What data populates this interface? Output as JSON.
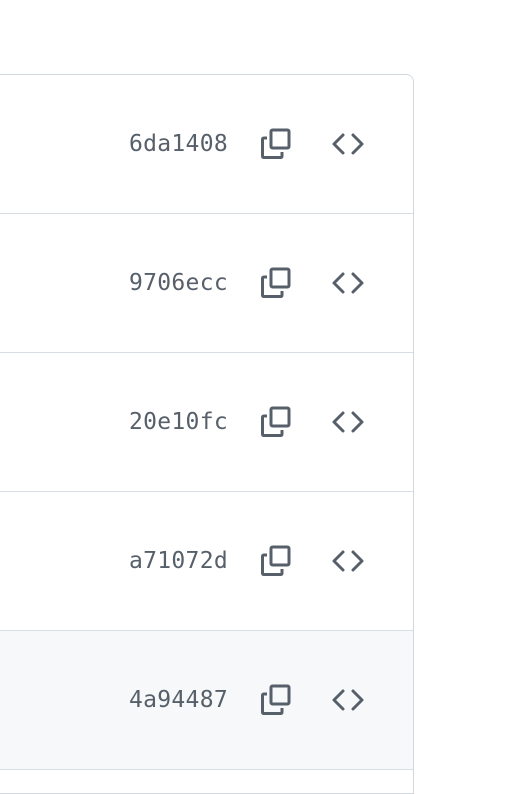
{
  "commits": [
    {
      "sha": "6da1408",
      "copy_icon": "copy-icon",
      "browse_icon": "code-brackets-icon",
      "highlighted": false
    },
    {
      "sha": "9706ecc",
      "copy_icon": "copy-icon",
      "browse_icon": "code-brackets-icon",
      "highlighted": false
    },
    {
      "sha": "20e10fc",
      "copy_icon": "copy-icon",
      "browse_icon": "code-brackets-icon",
      "highlighted": false
    },
    {
      "sha": "a71072d",
      "copy_icon": "copy-icon",
      "browse_icon": "code-brackets-icon",
      "highlighted": false
    },
    {
      "sha": "4a94487",
      "copy_icon": "copy-icon",
      "browse_icon": "code-brackets-icon",
      "highlighted": true
    }
  ],
  "colors": {
    "sha_text": "#57606a",
    "icon": "#57606a",
    "border": "#d0d7de",
    "row_divider": "#d8dee4",
    "highlight_bg": "#f6f8fa"
  }
}
